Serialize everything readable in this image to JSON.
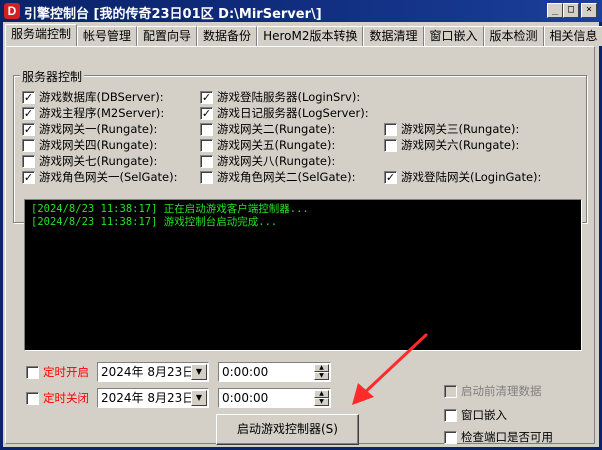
{
  "window": {
    "title": "引擎控制台 [我的传奇23日01区 D:\\MirServer\\]",
    "app_icon": "D",
    "controls": [
      "_",
      "□",
      "×"
    ]
  },
  "tabs": [
    {
      "label": "服务端控制",
      "active": true
    },
    {
      "label": "帐号管理"
    },
    {
      "label": "配置向导"
    },
    {
      "label": "数据备份"
    },
    {
      "label": "HeroM2版本转换"
    },
    {
      "label": "数据清理"
    },
    {
      "label": "窗口嵌入"
    },
    {
      "label": "版本检测"
    },
    {
      "label": "相关信息"
    }
  ],
  "group": {
    "title": "服务器控制"
  },
  "servers": [
    {
      "label": "游戏数据库(DBServer):",
      "checked": true
    },
    {
      "label": "游戏登陆服务器(LoginSrv):",
      "checked": true
    },
    {
      "label": "游戏主程序(M2Server):",
      "checked": true
    },
    {
      "label": "游戏日记服务器(LogServer):",
      "checked": true
    },
    {
      "label": "游戏网关一(Rungate):",
      "checked": true
    },
    {
      "label": "游戏网关二(Rungate):",
      "checked": false
    },
    {
      "label": "游戏网关三(Rungate):",
      "checked": false
    },
    {
      "label": "游戏网关四(Rungate):",
      "checked": false
    },
    {
      "label": "游戏网关五(Rungate):",
      "checked": false
    },
    {
      "label": "游戏网关六(Rungate):",
      "checked": false
    },
    {
      "label": "游戏网关七(Rungate):",
      "checked": false
    },
    {
      "label": "游戏网关八(Rungate):",
      "checked": false
    },
    {
      "label": "游戏角色网关一(SelGate):",
      "checked": true
    },
    {
      "label": "游戏角色网关二(SelGate):",
      "checked": false
    },
    {
      "label": "游戏登陆网关(LoginGate):",
      "checked": true
    }
  ],
  "log": [
    "[2024/8/23 11:38:17] 正在启动游戏客户端控制器...",
    "[2024/8/23 11:38:17] 游戏控制台启动完成..."
  ],
  "schedule": {
    "start": {
      "label": "定时开启",
      "checked": false,
      "date": "2024年 8月23日",
      "time": "0:00:00"
    },
    "stop": {
      "label": "定时关闭",
      "checked": false,
      "date": "2024年 8月23日",
      "time": "0:00:00"
    }
  },
  "options": [
    {
      "label": "启动前清理数据",
      "checked": false,
      "disabled": true
    },
    {
      "label": "窗口嵌入",
      "checked": false,
      "disabled": false
    },
    {
      "label": "检查端口是否可用",
      "checked": false,
      "disabled": false
    }
  ],
  "start_button": {
    "label": "启动游戏控制器(S)"
  },
  "colors": {
    "titlebar": "#0a246a",
    "face": "#d4d0c8",
    "log_bg": "#000000",
    "log_text": "#28e028",
    "arrow": "#ff2a2a",
    "schedule_label": "#ff0000"
  }
}
